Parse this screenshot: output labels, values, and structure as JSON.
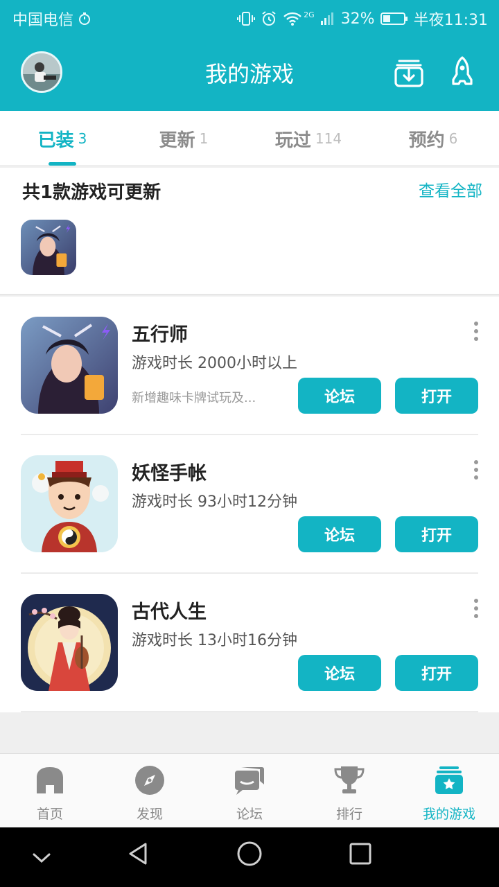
{
  "status_bar": {
    "carrier": "中国电信",
    "network": "2G",
    "battery": "32%",
    "time": "半夜11:31"
  },
  "header": {
    "title": "我的游戏"
  },
  "tabs": [
    {
      "label": "已装",
      "count": "3",
      "active": true
    },
    {
      "label": "更新",
      "count": "1",
      "active": false
    },
    {
      "label": "玩过",
      "count": "114",
      "active": false
    },
    {
      "label": "预约",
      "count": "6",
      "active": false
    }
  ],
  "updates": {
    "title": "共1款游戏可更新",
    "view_all": "查看全部"
  },
  "games": [
    {
      "name": "五行师",
      "play_time": "游戏时长 2000小时以上",
      "note": "新增趣味卡牌试玩及...",
      "forum": "论坛",
      "open": "打开"
    },
    {
      "name": "妖怪手帐",
      "play_time": "游戏时长 93小时12分钟",
      "note": "",
      "forum": "论坛",
      "open": "打开"
    },
    {
      "name": "古代人生",
      "play_time": "游戏时长 13小时16分钟",
      "note": "",
      "forum": "论坛",
      "open": "打开"
    }
  ],
  "bottom_nav": [
    {
      "label": "首页",
      "icon": "home-icon"
    },
    {
      "label": "发现",
      "icon": "compass-icon"
    },
    {
      "label": "论坛",
      "icon": "chat-icon"
    },
    {
      "label": "排行",
      "icon": "trophy-icon"
    },
    {
      "label": "我的游戏",
      "icon": "my-games-icon",
      "active": true
    }
  ],
  "colors": {
    "accent": "#13b4c4",
    "inactive": "#8c8c8c"
  }
}
